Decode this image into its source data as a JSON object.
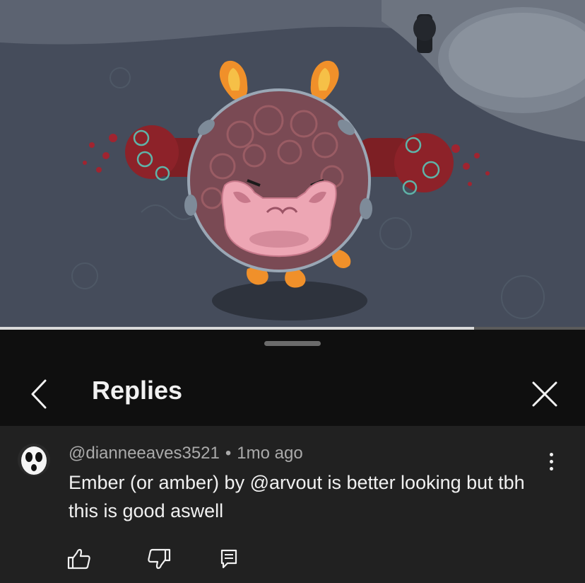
{
  "player": {
    "progress_fraction": 0.81
  },
  "header": {
    "title": "Replies",
    "back_icon": "chevron-left-icon",
    "close_icon": "close-icon"
  },
  "comment": {
    "author": "@dianneeaves3521",
    "separator": "•",
    "time": "1mo ago",
    "text": "Ember (or amber) by @arvout is better looking but tbh this is good aswell",
    "avatar_icon": "shy-guy-mask-avatar",
    "actions": {
      "like_icon": "thumbs-up-icon",
      "dislike_icon": "thumbs-down-icon",
      "reply_icon": "reply-icon",
      "more_icon": "more-vertical-icon"
    }
  },
  "colors": {
    "sheet_background": "#0f0f0f",
    "comment_background": "#212121",
    "primary_text": "#f1f1f1",
    "secondary_text": "#aaaaaa"
  }
}
